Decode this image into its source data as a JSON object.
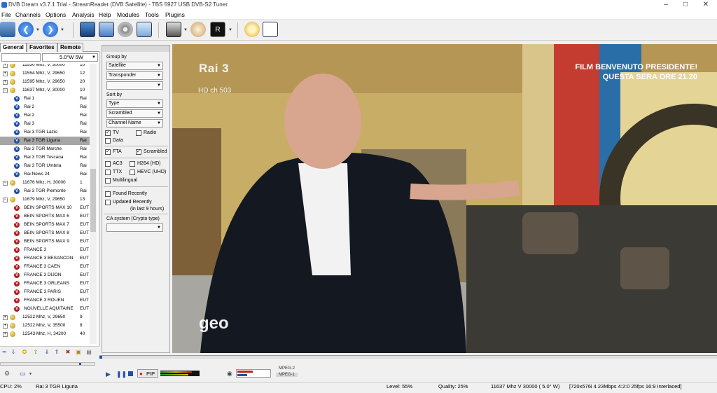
{
  "window": {
    "title": "DVB Dream v3.7.1 Trial - StreamReader (DVB Satellite) - TBS 5927 USB DVB-S2 Tuner",
    "min_label": "–",
    "max_label": "□",
    "close_label": "✕"
  },
  "menu": [
    "File",
    "Channels",
    "Options",
    "Analysis",
    "Help",
    "Modules",
    "Tools",
    "Plugins"
  ],
  "tabs": [
    "General",
    "Favorites",
    "Remote"
  ],
  "satellite": {
    "value": "5.0°W 5W",
    "prefix": ""
  },
  "channels": [
    {
      "kind": "tp",
      "label": "11530 Mhz, V, 30000",
      "prov": "10",
      "cut": true
    },
    {
      "kind": "tp",
      "label": "11554 Mhz, V, 29650",
      "prov": "12"
    },
    {
      "kind": "tp",
      "label": "11595 Mhz, V, 29650",
      "prov": "20"
    },
    {
      "kind": "tp",
      "label": "11637 Mhz, V, 30000",
      "prov": "10",
      "expanded": true
    },
    {
      "kind": "ch",
      "label": "Rai 1",
      "prov": "Rai",
      "icon": "v"
    },
    {
      "kind": "ch",
      "label": "Rai 2",
      "prov": "Rai",
      "icon": "v"
    },
    {
      "kind": "ch",
      "label": "Rai 2",
      "prov": "Rai",
      "icon": "v"
    },
    {
      "kind": "ch",
      "label": "Rai 3",
      "prov": "Rai",
      "icon": "v"
    },
    {
      "kind": "ch",
      "label": "Rai 3 TGR Lazio",
      "prov": "Rai",
      "icon": "v"
    },
    {
      "kind": "ch",
      "label": "Rai 3 TGR Liguria",
      "prov": "Rai",
      "icon": "v",
      "selected": true
    },
    {
      "kind": "ch",
      "label": "Rai 3 TGR Marche",
      "prov": "Rai",
      "icon": "v"
    },
    {
      "kind": "ch",
      "label": "Rai 3 TGR Toscana",
      "prov": "Rai",
      "icon": "v"
    },
    {
      "kind": "ch",
      "label": "Rai 3 TGR Umbria",
      "prov": "Rai",
      "icon": "v"
    },
    {
      "kind": "ch",
      "label": "Rai News 24",
      "prov": "Rai",
      "icon": "v"
    },
    {
      "kind": "tp",
      "label": "11676 Mhz, H, 30000",
      "prov": "1",
      "expanded": true
    },
    {
      "kind": "ch",
      "label": "Rai 3 TGR Piemonte",
      "prov": "Rai",
      "icon": "v"
    },
    {
      "kind": "tp",
      "label": "11679 Mhz, V, 29650",
      "prov": "13",
      "expanded": true
    },
    {
      "kind": "ch",
      "label": "BEIN SPORTS MAX 10",
      "prov": "EUT",
      "icon": "r"
    },
    {
      "kind": "ch",
      "label": "BEIN SPORTS MAX 6",
      "prov": "EUT",
      "icon": "r"
    },
    {
      "kind": "ch",
      "label": "BEIN SPORTS MAX 7",
      "prov": "EUT",
      "icon": "r"
    },
    {
      "kind": "ch",
      "label": "BEIN SPORTS MAX 8",
      "prov": "EUT",
      "icon": "r"
    },
    {
      "kind": "ch",
      "label": "BEIN SPORTS MAX 9",
      "prov": "EUT",
      "icon": "r"
    },
    {
      "kind": "ch",
      "label": "FRANCE 3",
      "prov": "EUT",
      "icon": "r"
    },
    {
      "kind": "ch",
      "label": "FRANCE 3 BESANCON",
      "prov": "EUT",
      "icon": "r"
    },
    {
      "kind": "ch",
      "label": "FRANCE 3 CAEN",
      "prov": "EUT",
      "icon": "r"
    },
    {
      "kind": "ch",
      "label": "FRANCE 3 DIJON",
      "prov": "EUT",
      "icon": "r"
    },
    {
      "kind": "ch",
      "label": "FRANCE 3 ORLEANS",
      "prov": "EUT",
      "icon": "r"
    },
    {
      "kind": "ch",
      "label": "FRANCE 3 PARIS",
      "prov": "EUT",
      "icon": "r"
    },
    {
      "kind": "ch",
      "label": "FRANCE 3 ROUEN",
      "prov": "EUT",
      "icon": "r"
    },
    {
      "kind": "ch",
      "label": "NOUVELLE AQUITAINE",
      "prov": "EUT",
      "icon": "r"
    },
    {
      "kind": "tp",
      "label": "12522 Mhz, V, 29650",
      "prov": "9"
    },
    {
      "kind": "tp",
      "label": "12522 Mhz, V, 35500",
      "prov": "8"
    },
    {
      "kind": "tp",
      "label": "12543 Mhz, H, 34200",
      "prov": "40"
    }
  ],
  "filters": {
    "group_by_label": "Group by",
    "group1": "Satellite",
    "group2": "Transponder",
    "group3": "",
    "sort_by_label": "Sort by",
    "sort1": "Type",
    "sort2": "Scrambled",
    "sort3": "Channel Name",
    "tv": "TV",
    "radio": "Radio",
    "data": "Data",
    "fta": "FTA",
    "scrambled": "Scrambled",
    "ac3": "AC3",
    "h264": "H264 (HD)",
    "ttx": "TTX",
    "hevc": "HEVC (UHD)",
    "multilingual": "Multilingual",
    "found_recently": "Found Recently",
    "updated_recently": "Updated Recently",
    "updated_note": "(in last 9 hours)",
    "ca_system_label": "CA system (Crypto type)",
    "ca_value": ""
  },
  "video": {
    "logo": "Rai 3",
    "hd_label": "HD ch 503",
    "promo_line1": "FILM BENVENUTO PRESIDENTE!",
    "promo_line2": "QUESTA SERA ORE 21.20",
    "watermark": "geo"
  },
  "controls": {
    "pip_label": "PIP",
    "codec1": "MPEG-2",
    "codec2": "MPEG-1",
    "progress": 0.005
  },
  "status": {
    "cpu": "CPU: 2%",
    "channel": "Rai 3 TGR Liguria",
    "level": "Level: 55%",
    "quality": "Quality: 25%",
    "transponder": "11637 Mhz  V  30000  ( 5.0° W)",
    "stream": "[720x576i  4.23Mbps 4:2:0 25fps 16:9 Interlaced]"
  },
  "colors": {
    "accent": "#1f4fa8",
    "selected_row": "#a6a6a6",
    "video_bg": "#c9ae6a"
  }
}
